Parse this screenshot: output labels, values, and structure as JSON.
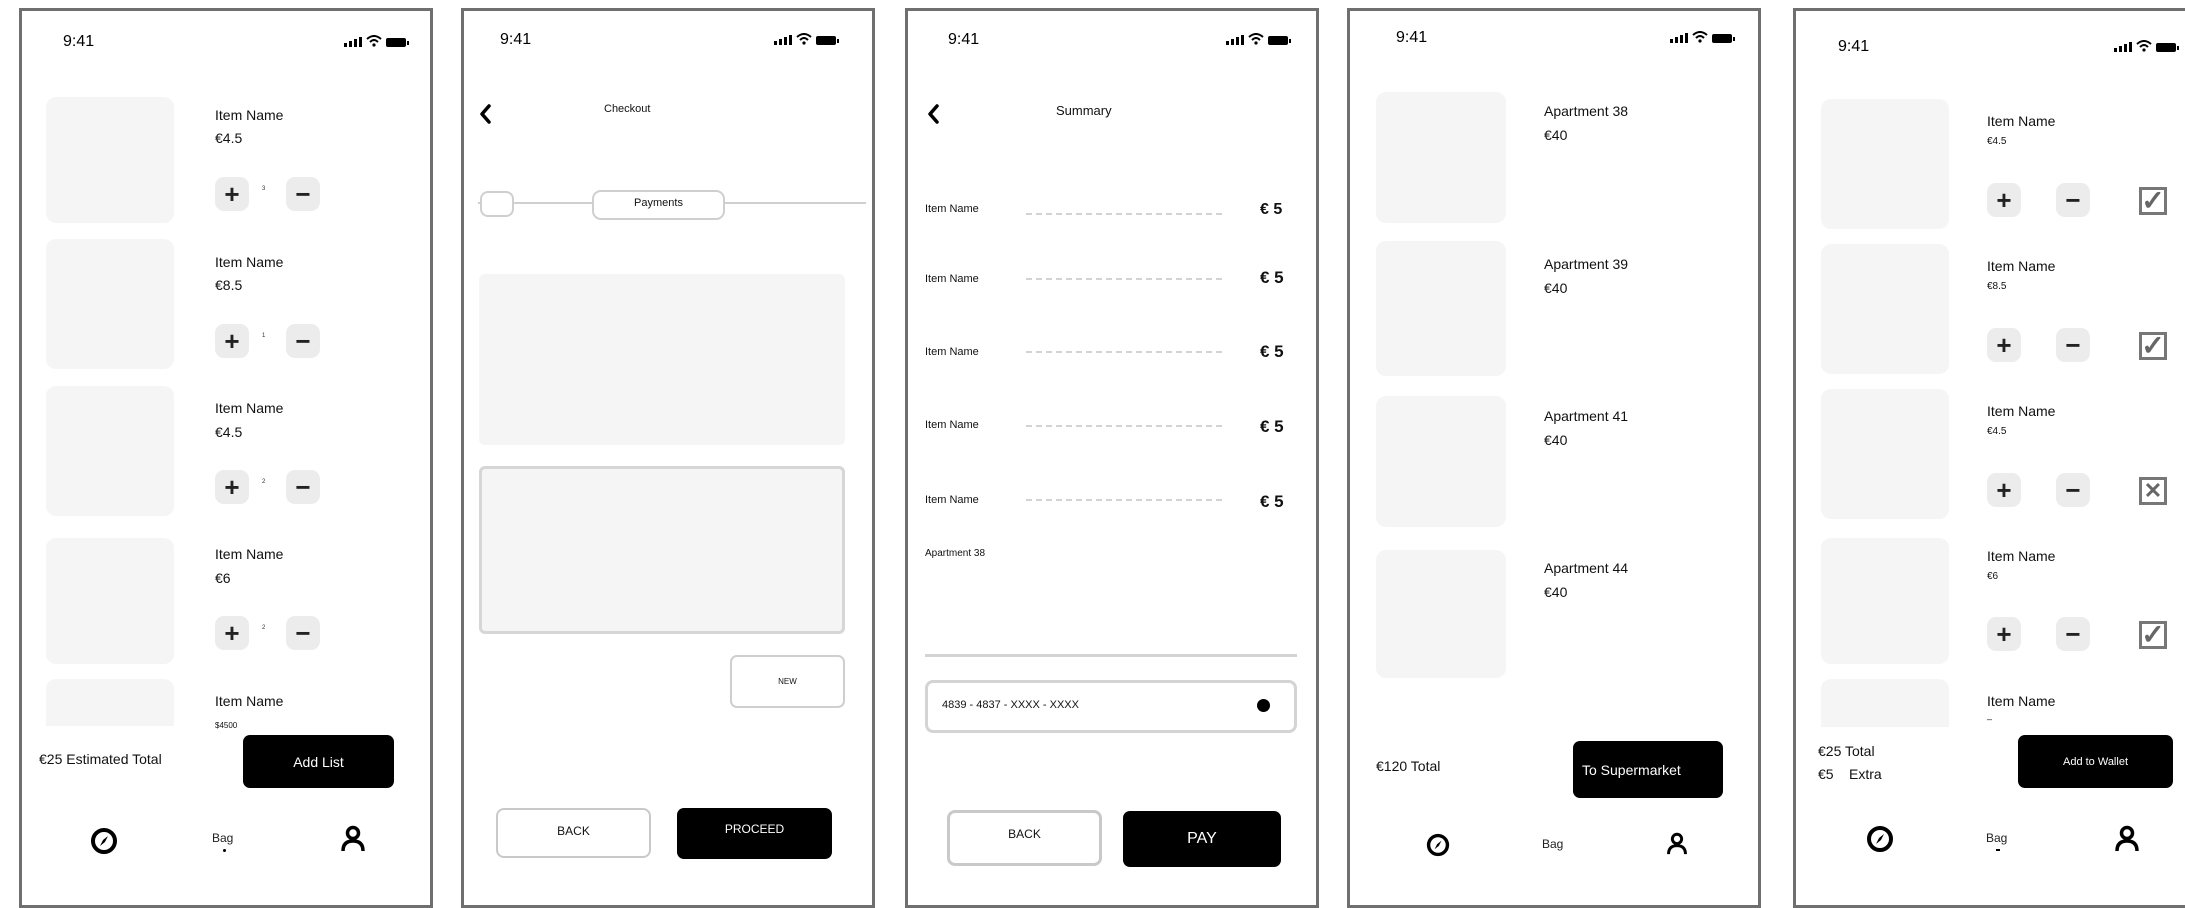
{
  "status_bar": {
    "time": "9:41"
  },
  "screen1": {
    "items": [
      {
        "name": "Item Name",
        "price": "€4.5",
        "qty": "3"
      },
      {
        "name": "Item Name",
        "price": "€8.5",
        "qty": "1"
      },
      {
        "name": "Item Name",
        "price": "€4.5",
        "qty": "2"
      },
      {
        "name": "Item Name",
        "price": "€6",
        "qty": "2"
      },
      {
        "name": "Item Name",
        "price": "$4500"
      }
    ],
    "total_label": "€25 Estimated Total",
    "add_list_label": "Add List",
    "nav": {
      "bag_label": "Bag"
    }
  },
  "screen2": {
    "title": "Checkout",
    "step_label": "Payments",
    "new_label": "NEW",
    "back_label": "BACK",
    "proceed_label": "PROCEED"
  },
  "screen3": {
    "title": "Summary",
    "lines": [
      {
        "name": "Item Name",
        "amount": "€ 5"
      },
      {
        "name": "Item Name",
        "amount": "€ 5"
      },
      {
        "name": "Item Name",
        "amount": "€ 5"
      },
      {
        "name": "Item Name",
        "amount": "€ 5"
      },
      {
        "name": "Item Name",
        "amount": "€ 5"
      }
    ],
    "address": "Apartment 38",
    "card_number": "4839 - 4837 - XXXX - XXXX",
    "back_label": "BACK",
    "pay_label": "PAY"
  },
  "screen4": {
    "apartments": [
      {
        "name": "Apartment 38",
        "price": "€40"
      },
      {
        "name": "Apartment 39",
        "price": "€40"
      },
      {
        "name": "Apartment 41",
        "price": "€40"
      },
      {
        "name": "Apartment 44",
        "price": "€40"
      }
    ],
    "total_label": "€120 Total",
    "supermarket_label": "To Supermarket",
    "nav": {
      "bag_label": "Bag"
    }
  },
  "screen5": {
    "items": [
      {
        "name": "Item Name",
        "price": "€4.5",
        "check": "checked"
      },
      {
        "name": "Item Name",
        "price": "€8.5",
        "check": "checked"
      },
      {
        "name": "Item Name",
        "price": "€4.5",
        "check": "crossed"
      },
      {
        "name": "Item Name",
        "price": "€6",
        "check": "checked"
      },
      {
        "name": "Item Name",
        "price": "–"
      }
    ],
    "total_label": "€25 Total",
    "extra_amount": "€5",
    "extra_label": "Extra",
    "wallet_label": "Add to Wallet",
    "nav": {
      "bag_label": "Bag"
    }
  }
}
